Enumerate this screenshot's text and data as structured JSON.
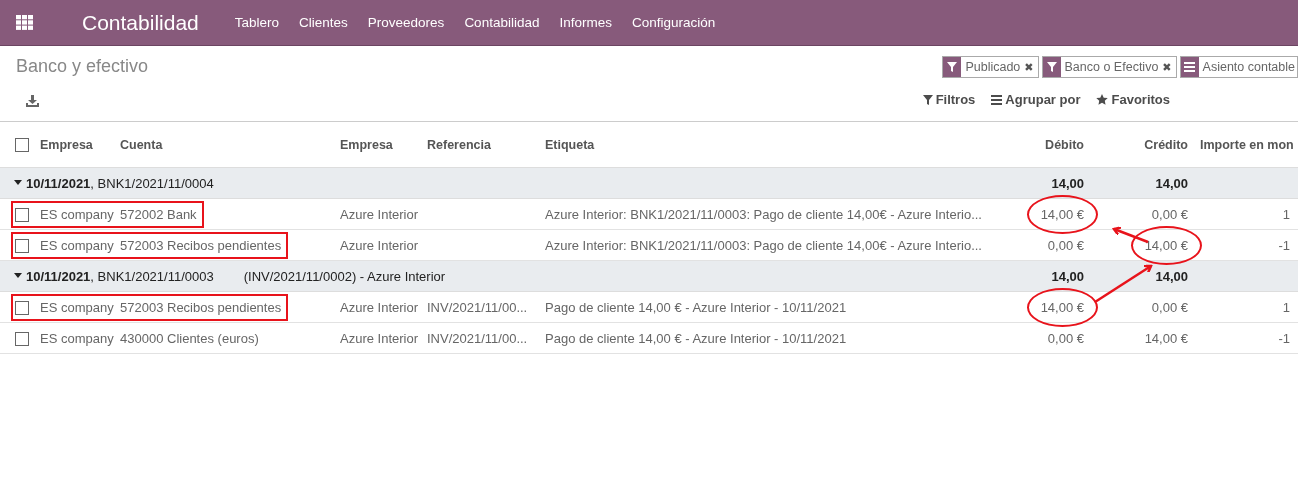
{
  "navbar": {
    "app_name": "Contabilidad",
    "menu": [
      "Tablero",
      "Clientes",
      "Proveedores",
      "Contabilidad",
      "Informes",
      "Configuración"
    ]
  },
  "breadcrumb": "Banco y efectivo",
  "facets": [
    {
      "kind": "filter",
      "label": "Publicado",
      "remove": "✖"
    },
    {
      "kind": "filter",
      "label": "Banco o Efectivo",
      "remove": "✖"
    },
    {
      "kind": "group",
      "label": "Asiento contable"
    }
  ],
  "search_options": [
    {
      "kind": "filter",
      "label": "Filtros"
    },
    {
      "kind": "group",
      "label": "Agrupar por"
    },
    {
      "kind": "favorite",
      "label": "Favoritos"
    }
  ],
  "table": {
    "select_all_checked": false,
    "columns": [
      "Empresa",
      "Cuenta",
      "Empresa",
      "Referencia",
      "Etiqueta",
      "Débito",
      "Crédito",
      "Importe en mon"
    ],
    "groups": [
      {
        "date": "10/11/2021",
        "title": ", BNK1/2021/11/0004",
        "expanded": true,
        "debit": "14,00",
        "credit": "14,00",
        "rows": [
          {
            "checked": false,
            "boxed": true,
            "company": "ES company",
            "account": "572002 Bank",
            "partner": "Azure Interior",
            "label": "Azure Interior: BNK1/2021/11/0003: Pago de cliente 14,00€ - Azure Interio...",
            "debit": "14,00 €",
            "debit_circled": true,
            "credit": "0,00 €",
            "credit_circled": false,
            "amount": "1"
          },
          {
            "checked": false,
            "boxed": true,
            "company": "ES company",
            "account": "572003 Recibos pendientes",
            "partner": "Azure Interior",
            "label": "Azure Interior: BNK1/2021/11/0003: Pago de cliente 14,00€ - Azure Interio...",
            "debit": "0,00 €",
            "debit_circled": false,
            "credit": "14,00 €",
            "credit_circled": true,
            "amount": "-1"
          }
        ]
      },
      {
        "date": "10/11/2021",
        "title": ", BNK1/2021/11/0003",
        "extra": "(INV/2021/11/0002) - Azure Interior",
        "expanded": true,
        "debit": "14,00",
        "credit": "14,00",
        "rows": [
          {
            "checked": false,
            "boxed": true,
            "company": "ES company",
            "account": "572003 Recibos pendientes",
            "partner": "Azure Interior",
            "reference": "INV/2021/11/00...",
            "label": "Pago de cliente 14,00 € - Azure Interior - 10/11/2021",
            "debit": "14,00 €",
            "debit_circled": true,
            "credit": "0,00 €",
            "credit_circled": false,
            "amount": "1"
          },
          {
            "checked": false,
            "boxed": false,
            "company": "ES company",
            "account": "430000 Clientes (euros)",
            "partner": "Azure Interior",
            "reference": "INV/2021/11/00...",
            "label": "Pago de cliente 14,00 € - Azure Interior - 10/11/2021",
            "debit": "0,00 €",
            "debit_circled": false,
            "credit": "14,00 €",
            "credit_circled": false,
            "amount": "-1"
          }
        ]
      }
    ]
  }
}
